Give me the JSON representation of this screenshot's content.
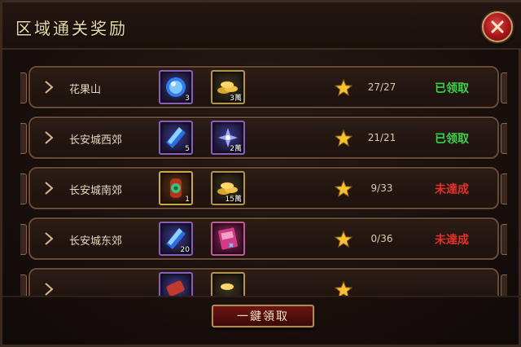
{
  "window": {
    "title": "区域通关奖励"
  },
  "rows": [
    {
      "region": "花果山",
      "item1": {
        "icon": "blue-orb-icon",
        "qty": "3"
      },
      "item2": {
        "icon": "gold-coins-icon",
        "qty": "3萬"
      },
      "progress": "27/27",
      "status": "已领取",
      "status_color": "#39d24b"
    },
    {
      "region": "长安城西郊",
      "item1": {
        "icon": "blue-crystal-icon",
        "qty": "5"
      },
      "item2": {
        "icon": "sparkle-gem-icon",
        "qty": "2萬"
      },
      "progress": "21/21",
      "status": "已领取",
      "status_color": "#39d24b"
    },
    {
      "region": "长安城南郊",
      "item1": {
        "icon": "jade-lantern-icon",
        "qty": "1"
      },
      "item2": {
        "icon": "gold-coins-icon",
        "qty": "15萬"
      },
      "progress": "9/33",
      "status": "未達成",
      "status_color": "#e0322a"
    },
    {
      "region": "长安城东郊",
      "item1": {
        "icon": "blue-crystal-icon",
        "qty": "20"
      },
      "item2": {
        "icon": "exp-card-icon",
        "qty": ""
      },
      "progress": "0/36",
      "status": "未達成",
      "status_color": "#e0322a"
    },
    {
      "region": "",
      "item1": {
        "icon": "scroll-icon",
        "qty": ""
      },
      "item2": {
        "icon": "gold-coins-icon",
        "qty": ""
      },
      "progress": "",
      "status": "",
      "status_color": "#e0322a"
    }
  ],
  "footer": {
    "claim_all_label": "一鍵領取"
  }
}
